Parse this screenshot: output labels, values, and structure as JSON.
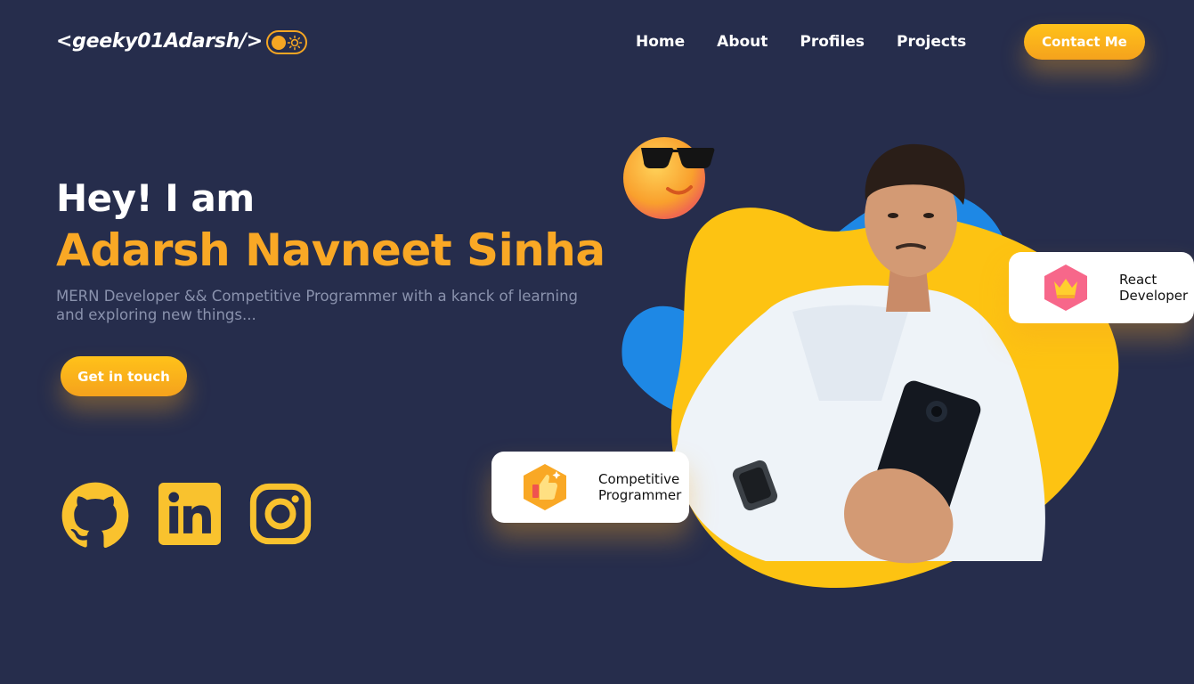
{
  "header": {
    "logo": "<geeky01Adarsh/>",
    "nav": [
      "Home",
      "About",
      "Profiles",
      "Projects"
    ],
    "contact_label": "Contact Me",
    "theme_toggle_icon": "sun-icon"
  },
  "hero": {
    "greeting": "Hey! I am",
    "name": "Adarsh Navneet Sinha",
    "tagline": "MERN Developer && Competitive Programmer with a kanck of learning and exploring new things...",
    "cta_label": "Get in touch"
  },
  "social": [
    {
      "icon": "github-icon"
    },
    {
      "icon": "linkedin-icon"
    },
    {
      "icon": "instagram-icon"
    }
  ],
  "badges": {
    "react": {
      "line1": "React",
      "line2": "Developer",
      "icon": "crown-icon"
    },
    "cp": {
      "line1": "Competitive",
      "line2": "Programmer",
      "icon": "thumbs-up-icon"
    }
  },
  "colors": {
    "background": "#262d4c",
    "accent": "#f9a825",
    "blob_yellow": "#fdc312",
    "blob_blue": "#1e88e5"
  }
}
